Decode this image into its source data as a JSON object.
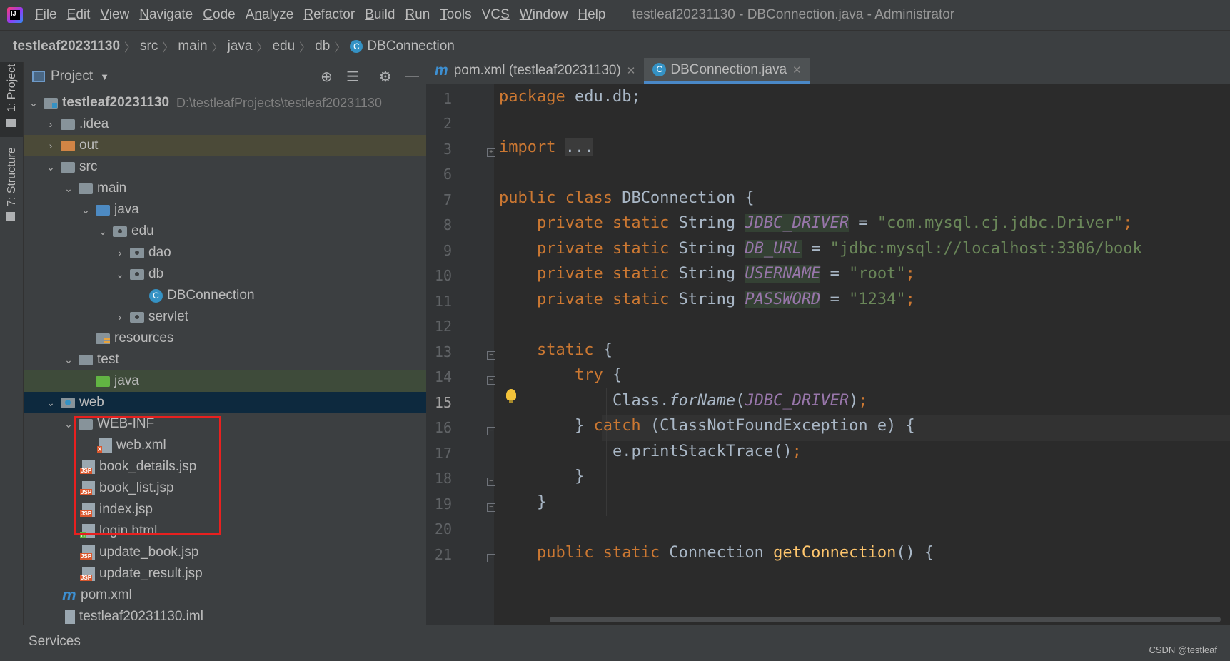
{
  "menubar": {
    "items": [
      "File",
      "Edit",
      "View",
      "Navigate",
      "Code",
      "Analyze",
      "Refactor",
      "Build",
      "Run",
      "Tools",
      "VCS",
      "Window",
      "Help"
    ],
    "mnemonic_index": [
      0,
      0,
      0,
      0,
      0,
      1,
      0,
      0,
      0,
      0,
      2,
      0,
      0
    ],
    "window_title": "testleaf20231130 - DBConnection.java - Administrator"
  },
  "breadcrumb": {
    "items": [
      "testleaf20231130",
      "src",
      "main",
      "java",
      "edu",
      "db",
      "DBConnection"
    ]
  },
  "side_tabs": {
    "project": "1: Project",
    "structure": "7: Structure"
  },
  "project_panel": {
    "title": "Project",
    "tree": [
      {
        "label": "testleaf20231130",
        "path": "D:\\testleafProjects\\testleaf20231130",
        "bold": true
      },
      {
        "label": ".idea"
      },
      {
        "label": "out"
      },
      {
        "label": "src"
      },
      {
        "label": "main"
      },
      {
        "label": "java"
      },
      {
        "label": "edu"
      },
      {
        "label": "dao"
      },
      {
        "label": "db"
      },
      {
        "label": "DBConnection"
      },
      {
        "label": "servlet"
      },
      {
        "label": "resources"
      },
      {
        "label": "test"
      },
      {
        "label": "java"
      },
      {
        "label": "web"
      },
      {
        "label": "WEB-INF"
      },
      {
        "label": "web.xml"
      },
      {
        "label": "book_details.jsp"
      },
      {
        "label": "book_list.jsp"
      },
      {
        "label": "index.jsp"
      },
      {
        "label": "login.html"
      },
      {
        "label": "update_book.jsp"
      },
      {
        "label": "update_result.jsp"
      },
      {
        "label": "pom.xml"
      },
      {
        "label": "testleaf20231130.iml"
      }
    ]
  },
  "editor": {
    "tabs": [
      {
        "label": "pom.xml (testleaf20231130)",
        "active": false
      },
      {
        "label": "DBConnection.java",
        "active": true
      }
    ],
    "line_numbers": [
      "1",
      "2",
      "3",
      "6",
      "7",
      "8",
      "9",
      "10",
      "11",
      "12",
      "13",
      "14",
      "15",
      "16",
      "17",
      "18",
      "19",
      "20",
      "21"
    ],
    "current_line": "15",
    "code": {
      "l1_kw": "package",
      "l1_rest": " edu.db;",
      "l3_kw": "import",
      "l3_dots": "...",
      "l7_kw": "public class",
      "l7_name": " DBConnection {",
      "ps": "private static",
      "string": " String ",
      "f1": "JDBC_DRIVER",
      "v1": "\"com.mysql.cj.jdbc.Driver\"",
      "f2": "DB_URL",
      "v2": "\"jdbc:mysql://localhost:3306/book",
      "f3": "USERNAME",
      "v3": "\"root\"",
      "f4": "PASSWORD",
      "v4": "\"1234\"",
      "static_kw": "static",
      "try_kw": "try",
      "l15_a": "Class.",
      "l15_m": "forName",
      "l15_arg": "JDBC_DRIVER",
      "catch_kw": "catch",
      "l16_rest": " (ClassNotFoundException e) {",
      "l17": "e.printStackTrace()",
      "l21_kw": "public static",
      "l21_type": " Connection ",
      "l21_m": "getConnection",
      "l21_rest": "() {"
    }
  },
  "bottom": {
    "services": "Services",
    "watermark": "CSDN @testleaf"
  },
  "colors": {
    "keyword": "#cc7832",
    "string": "#6a8759",
    "field": "#9876aa",
    "method": "#ffc66d",
    "highlight_box": "#e8201f"
  }
}
